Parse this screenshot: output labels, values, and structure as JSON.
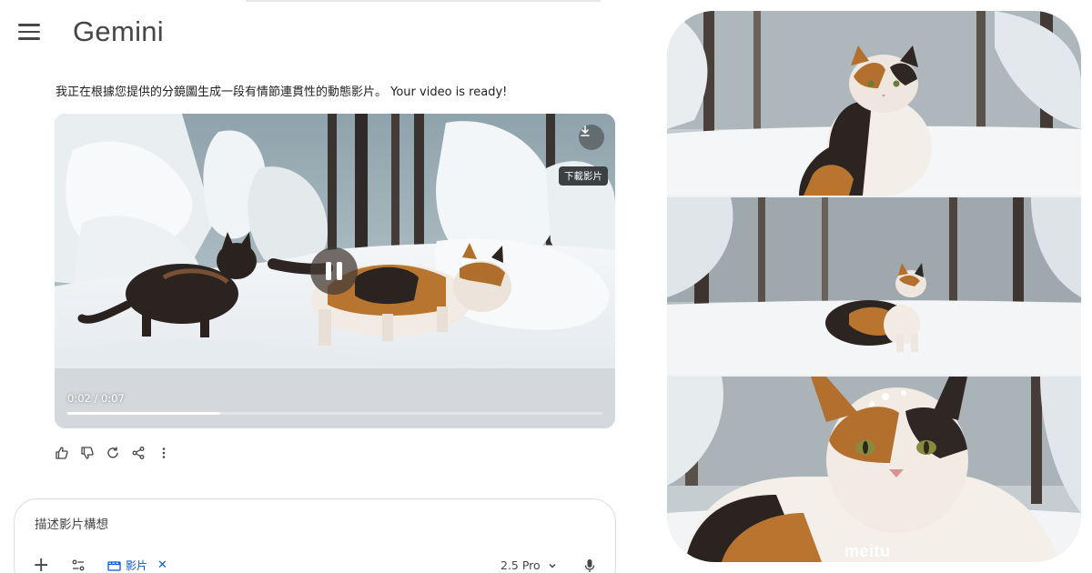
{
  "app": {
    "title": "Gemini"
  },
  "message": {
    "text": "我正在根據您提供的分鏡圖生成一段有情節連貫性的動態影片。 Your video is ready!"
  },
  "video": {
    "download_tooltip": "下載影片",
    "time_display": "0:02 / 0:07",
    "progress_fraction": 0.286,
    "state": "playing"
  },
  "actions": {
    "icons": [
      "thumb-up-icon",
      "thumb-down-icon",
      "regenerate-icon",
      "share-icon",
      "more-vert-icon"
    ]
  },
  "prompt": {
    "placeholder": "描述影片構想",
    "chip_label": "影片",
    "model_label": "2.5 Pro"
  },
  "collage": {
    "watermark": "meitu",
    "panels": [
      "calico-cat-sitting-snow",
      "calico-cat-standing-snow-field",
      "calico-cat-closeup-snow"
    ]
  },
  "colors": {
    "accent": "#0b57d0",
    "text": "#1f1f1f",
    "icon": "#444746"
  }
}
